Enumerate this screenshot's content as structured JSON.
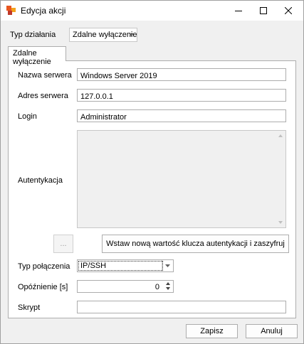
{
  "window": {
    "title": "Edycja akcji",
    "minimize_icon": "minimize-icon",
    "maximize_icon": "maximize-icon",
    "close_icon": "close-icon"
  },
  "action_type": {
    "label": "Typ działania",
    "selected": "Zdalne wyłączenie"
  },
  "tab": {
    "label": "Zdalne wyłączenie"
  },
  "form": {
    "server_name": {
      "label": "Nazwa serwera",
      "value": "Windows Server 2019"
    },
    "server_address": {
      "label": "Adres serwera",
      "value": "127.0.0.1"
    },
    "login": {
      "label": "Login",
      "value": "Administrator"
    },
    "auth": {
      "label": "Autentykacja",
      "value": ""
    },
    "ellipsis_button": "...",
    "encrypt_button": "Wstaw nową wartość klucza autentykacji i zaszyfruj",
    "connection_type": {
      "label": "Typ połączenia",
      "selected": "IP/SSH"
    },
    "delay": {
      "label": "Opóźnienie [s]",
      "value": "0"
    },
    "script": {
      "label": "Skrypt",
      "value": ""
    }
  },
  "footer": {
    "save_label": "Zapisz",
    "cancel_label": "Anuluj"
  }
}
